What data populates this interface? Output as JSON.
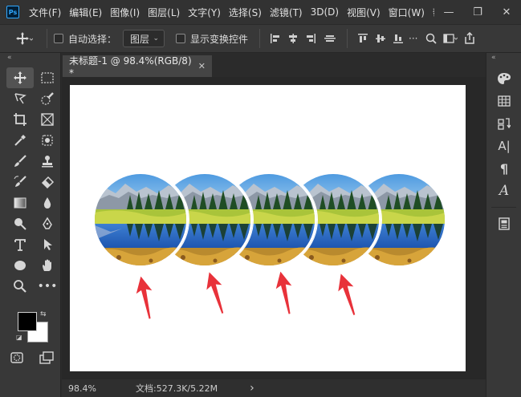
{
  "app": {
    "logo": "Ps",
    "menu": [
      "文件(F)",
      "编辑(E)",
      "图像(I)",
      "图层(L)",
      "文字(Y)",
      "选择(S)",
      "滤镜(T)",
      "3D(D)",
      "视图(V)",
      "窗口(W)",
      "帮"
    ],
    "window_controls": {
      "minimize": "—",
      "restore": "❐",
      "close": "✕"
    }
  },
  "options_bar": {
    "auto_select_label": "自动选择：",
    "auto_select_target": "图层",
    "show_transform_label": "显示变换控件"
  },
  "document": {
    "tab_title": "未标题-1 @ 98.4%(RGB/8) *",
    "close_glyph": "✕"
  },
  "status": {
    "zoom": "98.4%",
    "doc_info": "文档:527.3K/5.22M",
    "arrow": "›"
  },
  "colors": {
    "foreground": "#000000",
    "background": "#ffffff",
    "arrow_color": "#e8323a",
    "accent": "#31a8ff"
  },
  "icons": {
    "tools": [
      "move-icon",
      "marquee-icon",
      "lasso-icon",
      "quick-select-icon",
      "crop-icon",
      "frame-icon",
      "eyedropper-icon",
      "spot-heal-icon",
      "brush-icon",
      "stamp-icon",
      "history-brush-icon",
      "eraser-icon",
      "gradient-icon",
      "blur-icon",
      "dodge-icon",
      "pen-icon",
      "type-icon",
      "path-select-icon",
      "ellipse-icon",
      "hand-icon",
      "zoom-icon",
      "more-icon"
    ],
    "right_panel": [
      "color-palette-icon",
      "swatches-grid-icon",
      "history-icon",
      "character-icon",
      "paragraph-icon",
      "glyphs-icon",
      "properties-icon"
    ]
  },
  "canvas_content": {
    "circle_count": 5,
    "arrow_count": 4
  }
}
